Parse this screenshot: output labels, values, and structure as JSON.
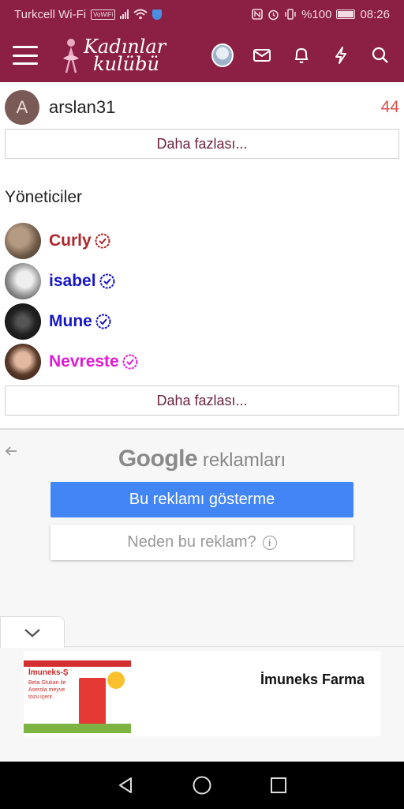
{
  "status_bar": {
    "carrier": "Turkcell Wi-Fi",
    "vowifi": "VoWiFi",
    "battery": "%100",
    "time": "08:26"
  },
  "app": {
    "logo_line1": "Kadınlar",
    "logo_line2": "kulübü",
    "brand_color": "#8b1f44"
  },
  "top_list": {
    "user": {
      "initial": "A",
      "name": "arslan31",
      "count": "44"
    },
    "more_label": "Daha fazlası..."
  },
  "staff_section": {
    "title": "Yöneticiler",
    "members": [
      {
        "name": "Curly",
        "color": "#b0262a"
      },
      {
        "name": "isabel",
        "color": "#1717c4"
      },
      {
        "name": "Mune",
        "color": "#1717c4"
      },
      {
        "name": "Nevreste",
        "color": "#e01bd6"
      }
    ],
    "more_label": "Daha fazlası..."
  },
  "ad_controls": {
    "google": "Google",
    "ads_word": "reklamları",
    "hide_ad": "Bu reklamı gösterme",
    "why_ad": "Neden bu reklam?",
    "info_glyph": "i"
  },
  "ad_banner": {
    "image_heading": "İmuneks-Ş",
    "image_text": "Beta Glukan ile Aserola meyve tozu içerir.",
    "advertiser": "İmuneks Farma"
  }
}
